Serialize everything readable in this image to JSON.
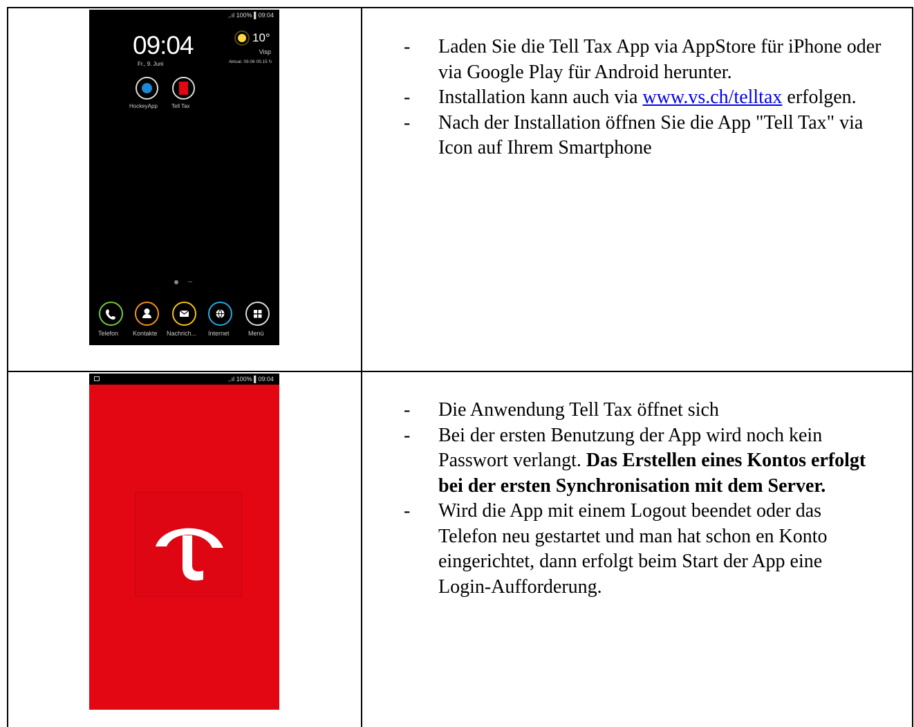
{
  "phone_home": {
    "status": "‚.ıl 100% ▌09:04",
    "clock": "09:04",
    "date": "Fr., 9. Juni",
    "temperature": "10°",
    "city": "Visp",
    "updated": "Aktual. 09.06 05:15 ↻",
    "apps": [
      {
        "label": "HockeyApp",
        "icon": "hockeyapp-icon"
      },
      {
        "label": "Tell Tax",
        "icon": "telltax-icon"
      }
    ],
    "dock": [
      {
        "label": "Telefon",
        "icon": "phone-icon",
        "color": "#7ac943"
      },
      {
        "label": "Kontakte",
        "icon": "contacts-icon",
        "color": "#f7941d"
      },
      {
        "label": "Nachrich...",
        "icon": "messages-icon",
        "color": "#f9c80e"
      },
      {
        "label": "Internet",
        "icon": "internet-icon",
        "color": "#29abe2"
      },
      {
        "label": "Menü",
        "icon": "apps-menu-icon",
        "color": "#dddddd"
      }
    ]
  },
  "phone_splash": {
    "status": "‚.ıl 100% ▌09:04",
    "logo": "telltax-logo",
    "bg_color": "#e30613"
  },
  "step1": {
    "bullet1": "Laden Sie die Tell Tax App via AppStore für iPhone oder via Google Play für Android herunter.",
    "bullet2_pre": "Installation kann auch via ",
    "bullet2_link": "www.vs.ch/telltax",
    "bullet2_post": " erfolgen.",
    "bullet3": "Nach der Installation öffnen Sie die App \"Tell Tax\" via Icon auf Ihrem Smartphone"
  },
  "step2": {
    "bullet1": "Die Anwendung Tell Tax öffnet sich",
    "bullet2_pre": "Bei der ersten Benutzung der App wird noch kein Passwort verlangt. ",
    "bullet2_bold": "Das Erstellen eines Kontos erfolgt bei der ersten Synchronisation mit dem Server.",
    "bullet3": "Wird die App mit einem Logout beendet oder das Telefon neu gestartet und man hat schon en Konto eingerichtet, dann erfolgt beim Start der App eine Login-Aufforderung."
  }
}
